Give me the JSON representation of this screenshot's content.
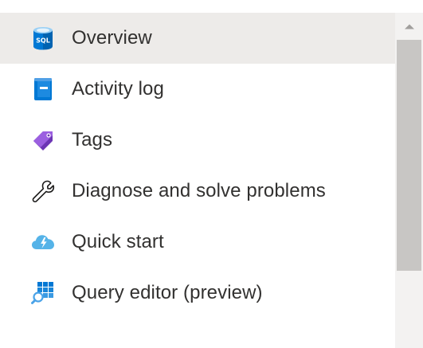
{
  "menu": {
    "items": [
      {
        "label": "Overview",
        "icon": "sql-database-icon",
        "selected": true
      },
      {
        "label": "Activity log",
        "icon": "activity-log-icon",
        "selected": false
      },
      {
        "label": "Tags",
        "icon": "tag-icon",
        "selected": false
      },
      {
        "label": "Diagnose and solve problems",
        "icon": "wrench-icon",
        "selected": false
      },
      {
        "label": "Quick start",
        "icon": "quick-start-cloud-icon",
        "selected": false
      },
      {
        "label": "Query editor (preview)",
        "icon": "query-editor-icon",
        "selected": false
      }
    ]
  },
  "scrollbar": {
    "up_icon": "scroll-up-arrow-icon"
  },
  "colors": {
    "selected_background": "#edebe9",
    "text": "#323130",
    "scroll_track": "#f3f2f1",
    "scroll_thumb": "#c8c6c4",
    "sql_blue": "#0078d4",
    "tag_purple": "#8a4fd6",
    "cloud_blue": "#55b3e8"
  },
  "icons": {
    "sql_badge_text": "SQL"
  }
}
